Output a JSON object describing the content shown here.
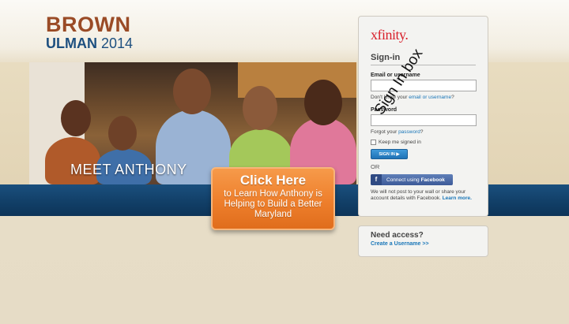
{
  "logo": {
    "line1": "BROWN",
    "line2": "ULMAN",
    "year": "2014"
  },
  "hero": {
    "caption": "MEET ANTHONY"
  },
  "cta": {
    "title": "Click Here",
    "subtitle": "to Learn How Anthony is Helping to Build a Better Maryland"
  },
  "signin": {
    "brand": "xfinity.",
    "title": "Sign-in",
    "email_label": "Email or username",
    "email_value": "",
    "email_help_prefix": "Don't know your",
    "email_help_link1": "email",
    "email_help_or": "or",
    "email_help_link2": "username",
    "email_help_suffix": "?",
    "password_label": "Password",
    "password_value": "",
    "password_help_prefix": "Forgot your",
    "password_help_link": "password",
    "password_help_suffix": "?",
    "remember_label": "Keep me signed in",
    "signin_button": "SIGN IN ▶",
    "or_label": "OR",
    "facebook_prefix": "Connect using",
    "facebook_bold": "Facebook",
    "fine_print": "We will not post to your wall or share your account details with Facebook.",
    "learn_more": "Learn more."
  },
  "annotation": {
    "text": "Sign In box"
  },
  "access": {
    "title": "Need access?",
    "link": "Create a Username >>"
  },
  "colors": {
    "brand_red": "#d8202b",
    "link_blue": "#1976b8",
    "cta_orange": "#ee7f2c",
    "band_blue": "#113e66",
    "logo_brown": "#9a4b26",
    "logo_blue": "#1d4f7f"
  }
}
